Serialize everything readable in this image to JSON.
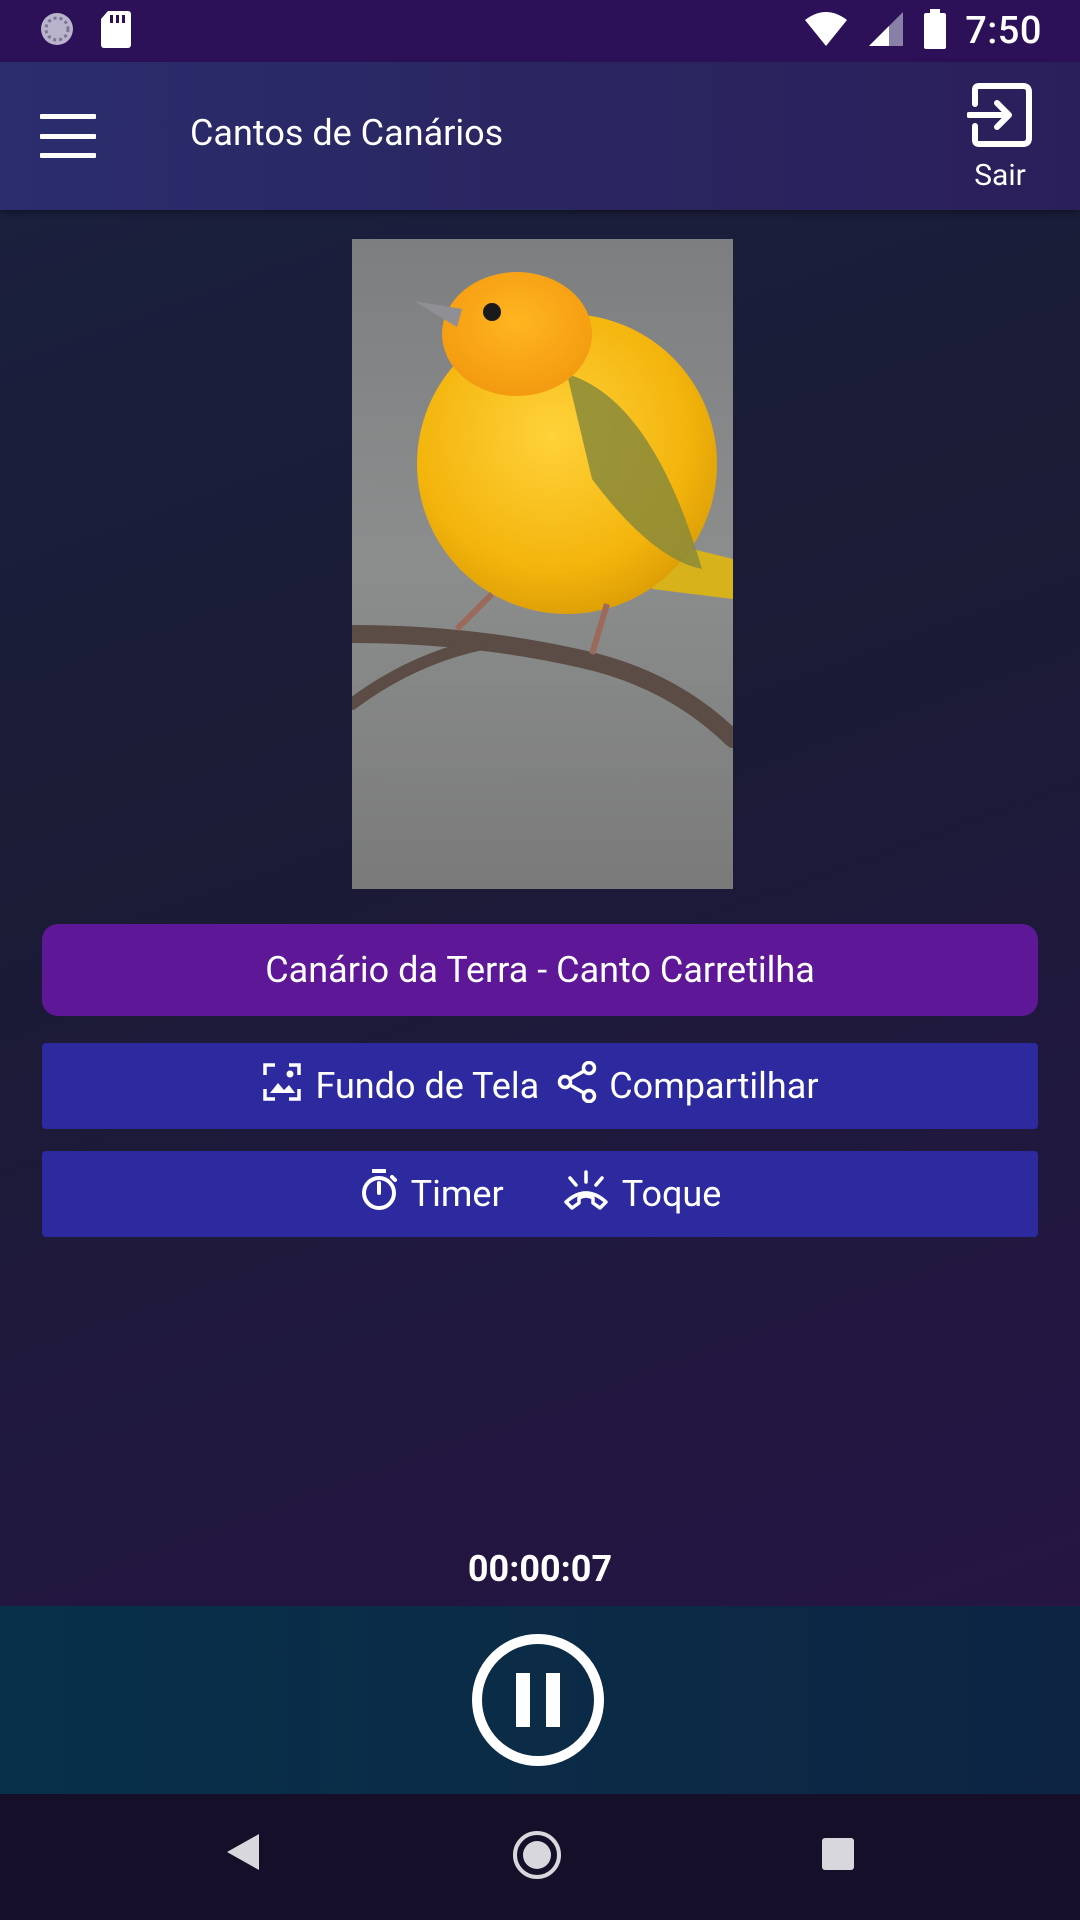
{
  "status_bar": {
    "time": "7:50",
    "icons": [
      "sync-icon",
      "sd-card-icon",
      "wifi-icon",
      "signal-icon",
      "battery-icon"
    ]
  },
  "toolbar": {
    "title": "Cantos de Canários",
    "exit_label": "Sair",
    "icons": [
      "menu-icon",
      "exit-icon"
    ]
  },
  "song": {
    "title": "Canário da Terra - Canto Carretilha"
  },
  "actions": {
    "wallpaper_label": "Fundo de Tela",
    "share_label": "Compartilhar",
    "timer_label": "Timer",
    "ringtone_label": "Toque"
  },
  "player": {
    "elapsed": "00:00:07",
    "state_icon": "pause-icon"
  },
  "colors": {
    "status_bar": "#2c1158",
    "toolbar": "#2a2a66",
    "song_button": "#5e1897",
    "action_button": "#2d2aa0",
    "player_bar": "#0a2c48",
    "nav_bar": "#160f2a"
  }
}
